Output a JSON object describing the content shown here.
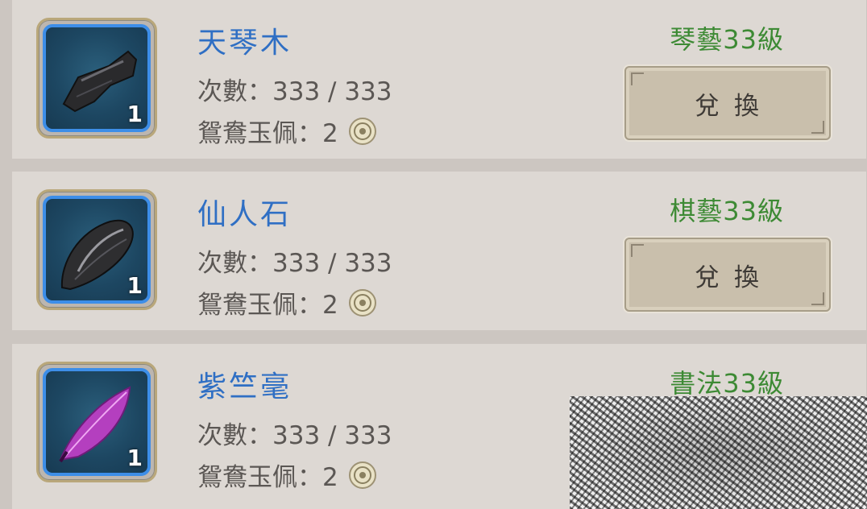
{
  "items": [
    {
      "name": "天琴木",
      "count_text": "次數：333 / 333",
      "cost_text": "鴛鴦玉佩：2",
      "quantity": "1",
      "requirement": "琴藝33級",
      "button_label": "兌換",
      "icon": "black-wood-icon"
    },
    {
      "name": "仙人石",
      "count_text": "次數：333 / 333",
      "cost_text": "鴛鴦玉佩：2",
      "quantity": "1",
      "requirement": "棋藝33級",
      "button_label": "兌換",
      "icon": "black-stone-icon"
    },
    {
      "name": "紫竺毫",
      "count_text": "次數：333 / 333",
      "cost_text": "鴛鴦玉佩：2",
      "quantity": "1",
      "requirement": "書法33級",
      "icon": "purple-feather-icon"
    }
  ],
  "colors": {
    "name": "#2f6fc4",
    "requirement": "#3d8a34",
    "slot_border": "#3d8ee8"
  }
}
